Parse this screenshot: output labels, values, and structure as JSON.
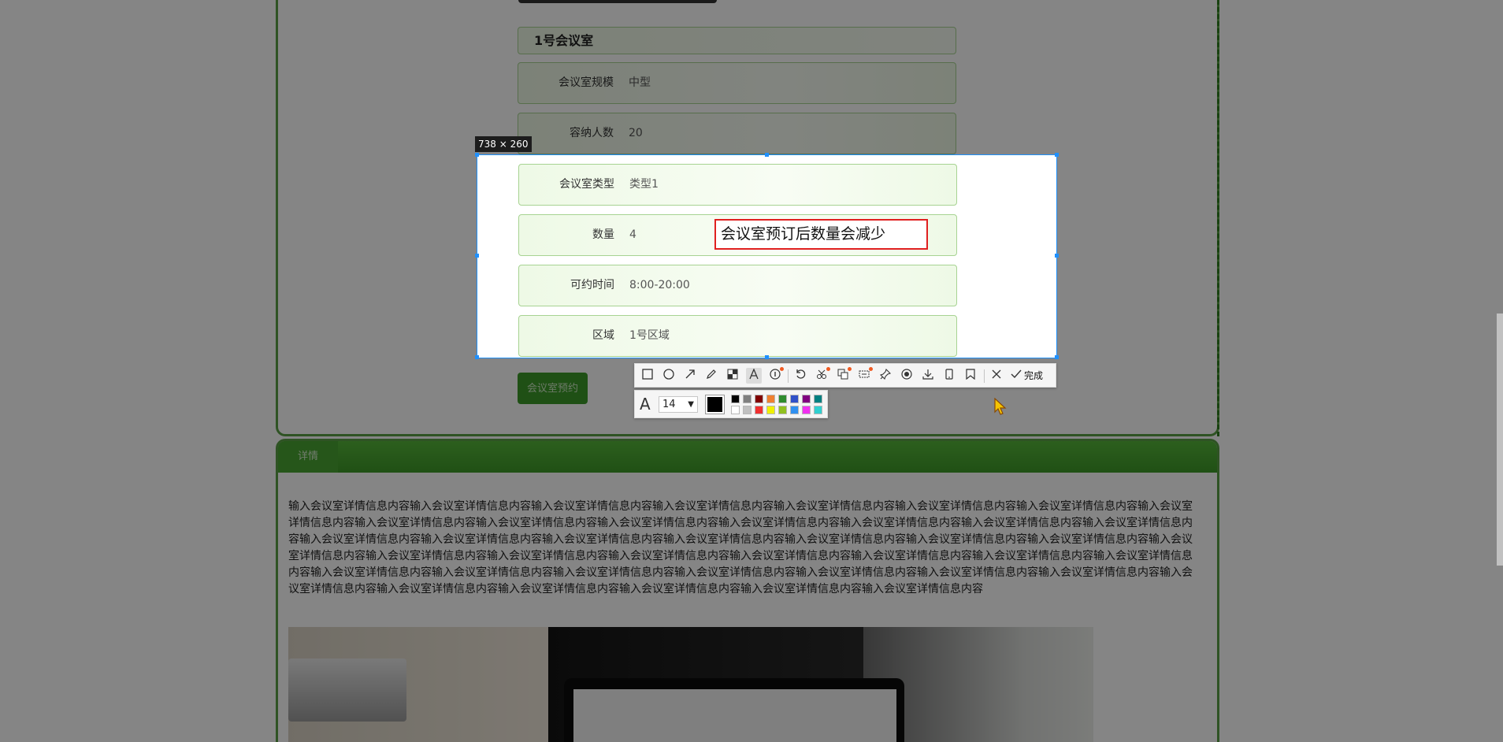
{
  "room": {
    "title": "1号会议室",
    "fields": [
      {
        "label": "会议室规模",
        "value": "中型"
      },
      {
        "label": "容纳人数",
        "value": "20"
      },
      {
        "label": "会议室类型",
        "value": "类型1"
      },
      {
        "label": "数量",
        "value": "4"
      },
      {
        "label": "可约时间",
        "value": "8:00-20:00"
      },
      {
        "label": "区域",
        "value": "1号区域"
      }
    ],
    "reserve_label": "会议室预约"
  },
  "detail": {
    "tab_label": "详情",
    "text": "输入会议室详情信息内容输入会议室详情信息内容输入会议室详情信息内容输入会议室详情信息内容输入会议室详情信息内容输入会议室详情信息内容输入会议室详情信息内容输入会议室详情信息内容输入会议室详情信息内容输入会议室详情信息内容输入会议室详情信息内容输入会议室详情信息内容输入会议室详情信息内容输入会议室详情信息内容输入会议室详情信息内容输入会议室详情信息内容输入会议室详情信息内容输入会议室详情信息内容输入会议室详情信息内容输入会议室详情信息内容输入会议室详情信息内容输入会议室详情信息内容输入会议室详情信息内容输入会议室详情信息内容输入会议室详情信息内容输入会议室详情信息内容输入会议室详情信息内容输入会议室详情信息内容输入会议室详情信息内容输入会议室详情信息内容输入会议室详情信息内容输入会议室详情信息内容输入会议室详情信息内容输入会议室详情信息内容输入会议室详情信息内容输入会议室详情信息内容输入会议室详情信息内容输入会议室详情信息内容输入会议室详情信息内容输入会议室详情信息内容输入会议室详情信息内容输入会议室详情信息内容输入会议室详情信息内容"
  },
  "screenshot_tool": {
    "size_label": "738 × 260",
    "annotation_text": "会议室预订后数量会减少",
    "done_label": "完成",
    "font_size": "14",
    "current_color": "#000000",
    "palette_top": [
      "#000000",
      "#808080",
      "#800000",
      "#f08030",
      "#2e8b2e",
      "#3050c8",
      "#800080",
      "#008080"
    ],
    "palette_bottom": [
      "#ffffff",
      "#c0c0c0",
      "#f03030",
      "#f0f000",
      "#90c020",
      "#3090f0",
      "#f030f0",
      "#30d0d0"
    ],
    "tools": [
      "rectangle-icon",
      "ellipse-icon",
      "arrow-icon",
      "pencil-icon",
      "mosaic-icon",
      "text-icon",
      "serial-number-icon",
      "undo-icon",
      "ocr-icon",
      "translate-icon",
      "scroll-capture-icon",
      "pin-icon",
      "record-icon",
      "download-icon",
      "mobile-icon",
      "bookmark-icon",
      "close-icon",
      "check-icon"
    ]
  }
}
